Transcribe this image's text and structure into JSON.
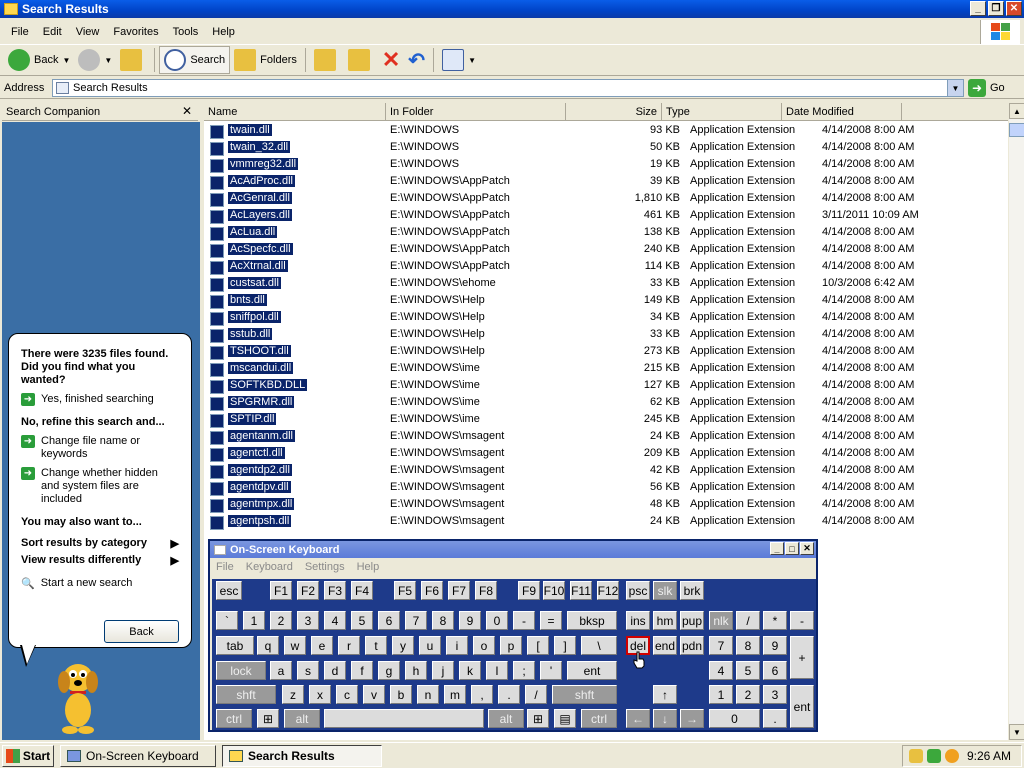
{
  "window": {
    "title": "Search Results"
  },
  "menu": [
    "File",
    "Edit",
    "View",
    "Favorites",
    "Tools",
    "Help"
  ],
  "toolbar": {
    "back": "Back",
    "search": "Search",
    "folders": "Folders"
  },
  "address": {
    "label": "Address",
    "value": "Search Results",
    "go": "Go"
  },
  "companion": {
    "title": "Search Companion",
    "found": "There were 3235 files found. Did you find what you wanted?",
    "yes": "Yes, finished searching",
    "refine": "No, refine this search and...",
    "change_name": "Change file name or keywords",
    "change_hidden": "Change whether hidden and system files are included",
    "also": "You may also want to...",
    "sort": "Sort results by category",
    "view": "View results differently",
    "new_search": "Start a new search",
    "back": "Back"
  },
  "columns": {
    "name": "Name",
    "folder": "In Folder",
    "size": "Size",
    "type": "Type",
    "date": "Date Modified"
  },
  "rows": [
    {
      "n": "twain.dll",
      "f": "E:\\WINDOWS",
      "s": "93 KB",
      "t": "Application Extension",
      "d": "4/14/2008 8:00 AM"
    },
    {
      "n": "twain_32.dll",
      "f": "E:\\WINDOWS",
      "s": "50 KB",
      "t": "Application Extension",
      "d": "4/14/2008 8:00 AM"
    },
    {
      "n": "vmmreg32.dll",
      "f": "E:\\WINDOWS",
      "s": "19 KB",
      "t": "Application Extension",
      "d": "4/14/2008 8:00 AM"
    },
    {
      "n": "AcAdProc.dll",
      "f": "E:\\WINDOWS\\AppPatch",
      "s": "39 KB",
      "t": "Application Extension",
      "d": "4/14/2008 8:00 AM"
    },
    {
      "n": "AcGenral.dll",
      "f": "E:\\WINDOWS\\AppPatch",
      "s": "1,810 KB",
      "t": "Application Extension",
      "d": "4/14/2008 8:00 AM"
    },
    {
      "n": "AcLayers.dll",
      "f": "E:\\WINDOWS\\AppPatch",
      "s": "461 KB",
      "t": "Application Extension",
      "d": "3/11/2011 10:09 AM"
    },
    {
      "n": "AcLua.dll",
      "f": "E:\\WINDOWS\\AppPatch",
      "s": "138 KB",
      "t": "Application Extension",
      "d": "4/14/2008 8:00 AM"
    },
    {
      "n": "AcSpecfc.dll",
      "f": "E:\\WINDOWS\\AppPatch",
      "s": "240 KB",
      "t": "Application Extension",
      "d": "4/14/2008 8:00 AM"
    },
    {
      "n": "AcXtrnal.dll",
      "f": "E:\\WINDOWS\\AppPatch",
      "s": "114 KB",
      "t": "Application Extension",
      "d": "4/14/2008 8:00 AM"
    },
    {
      "n": "custsat.dll",
      "f": "E:\\WINDOWS\\ehome",
      "s": "33 KB",
      "t": "Application Extension",
      "d": "10/3/2008 6:42 AM"
    },
    {
      "n": "bnts.dll",
      "f": "E:\\WINDOWS\\Help",
      "s": "149 KB",
      "t": "Application Extension",
      "d": "4/14/2008 8:00 AM"
    },
    {
      "n": "sniffpol.dll",
      "f": "E:\\WINDOWS\\Help",
      "s": "34 KB",
      "t": "Application Extension",
      "d": "4/14/2008 8:00 AM"
    },
    {
      "n": "sstub.dll",
      "f": "E:\\WINDOWS\\Help",
      "s": "33 KB",
      "t": "Application Extension",
      "d": "4/14/2008 8:00 AM"
    },
    {
      "n": "TSHOOT.dll",
      "f": "E:\\WINDOWS\\Help",
      "s": "273 KB",
      "t": "Application Extension",
      "d": "4/14/2008 8:00 AM"
    },
    {
      "n": "mscandui.dll",
      "f": "E:\\WINDOWS\\ime",
      "s": "215 KB",
      "t": "Application Extension",
      "d": "4/14/2008 8:00 AM"
    },
    {
      "n": "SOFTKBD.DLL",
      "f": "E:\\WINDOWS\\ime",
      "s": "127 KB",
      "t": "Application Extension",
      "d": "4/14/2008 8:00 AM"
    },
    {
      "n": "SPGRMR.dll",
      "f": "E:\\WINDOWS\\ime",
      "s": "62 KB",
      "t": "Application Extension",
      "d": "4/14/2008 8:00 AM"
    },
    {
      "n": "SPTIP.dll",
      "f": "E:\\WINDOWS\\ime",
      "s": "245 KB",
      "t": "Application Extension",
      "d": "4/14/2008 8:00 AM"
    },
    {
      "n": "agentanm.dll",
      "f": "E:\\WINDOWS\\msagent",
      "s": "24 KB",
      "t": "Application Extension",
      "d": "4/14/2008 8:00 AM"
    },
    {
      "n": "agentctl.dll",
      "f": "E:\\WINDOWS\\msagent",
      "s": "209 KB",
      "t": "Application Extension",
      "d": "4/14/2008 8:00 AM"
    },
    {
      "n": "agentdp2.dll",
      "f": "E:\\WINDOWS\\msagent",
      "s": "42 KB",
      "t": "Application Extension",
      "d": "4/14/2008 8:00 AM"
    },
    {
      "n": "agentdpv.dll",
      "f": "E:\\WINDOWS\\msagent",
      "s": "56 KB",
      "t": "Application Extension",
      "d": "4/14/2008 8:00 AM"
    },
    {
      "n": "agentmpx.dll",
      "f": "E:\\WINDOWS\\msagent",
      "s": "48 KB",
      "t": "Application Extension",
      "d": "4/14/2008 8:00 AM"
    },
    {
      "n": "agentpsh.dll",
      "f": "E:\\WINDOWS\\msagent",
      "s": "24 KB",
      "t": "Application Extension",
      "d": "4/14/2008 8:00 AM"
    }
  ],
  "osk": {
    "title": "On-Screen Keyboard",
    "menu": [
      "File",
      "Keyboard",
      "Settings",
      "Help"
    ]
  },
  "keys": [
    [
      "esc",
      4,
      2,
      26
    ],
    [
      "F1",
      58,
      2,
      22
    ],
    [
      "F2",
      85,
      2,
      22
    ],
    [
      "F3",
      112,
      2,
      22
    ],
    [
      "F4",
      139,
      2,
      22
    ],
    [
      "F5",
      182,
      2,
      22
    ],
    [
      "F6",
      209,
      2,
      22
    ],
    [
      "F7",
      236,
      2,
      22
    ],
    [
      "F8",
      263,
      2,
      22
    ],
    [
      "F9",
      306,
      2,
      22
    ],
    [
      "F10",
      331,
      2,
      22
    ],
    [
      "F11",
      358,
      2,
      22
    ],
    [
      "F12",
      385,
      2,
      22
    ],
    [
      "psc",
      414,
      2,
      24
    ],
    [
      "slk",
      441,
      2,
      24
    ],
    [
      "brk",
      468,
      2,
      24
    ],
    [
      "`",
      4,
      32,
      22
    ],
    [
      "1",
      31,
      32,
      22
    ],
    [
      "2",
      58,
      32,
      22
    ],
    [
      "3",
      85,
      32,
      22
    ],
    [
      "4",
      112,
      32,
      22
    ],
    [
      "5",
      139,
      32,
      22
    ],
    [
      "6",
      166,
      32,
      22
    ],
    [
      "7",
      193,
      32,
      22
    ],
    [
      "8",
      220,
      32,
      22
    ],
    [
      "9",
      247,
      32,
      22
    ],
    [
      "0",
      274,
      32,
      22
    ],
    [
      "-",
      301,
      32,
      22
    ],
    [
      "=",
      328,
      32,
      22
    ],
    [
      "bksp",
      355,
      32,
      50
    ],
    [
      "ins",
      414,
      32,
      24
    ],
    [
      "hm",
      441,
      32,
      24
    ],
    [
      "pup",
      468,
      32,
      24
    ],
    [
      "nlk",
      497,
      32,
      24
    ],
    [
      "/",
      524,
      32,
      24
    ],
    [
      "*",
      551,
      32,
      24
    ],
    [
      "-",
      578,
      32,
      24
    ],
    [
      "tab",
      4,
      57,
      38
    ],
    [
      "q",
      45,
      57,
      22
    ],
    [
      "w",
      72,
      57,
      22
    ],
    [
      "e",
      99,
      57,
      22
    ],
    [
      "r",
      126,
      57,
      22
    ],
    [
      "t",
      153,
      57,
      22
    ],
    [
      "y",
      180,
      57,
      22
    ],
    [
      "u",
      207,
      57,
      22
    ],
    [
      "i",
      234,
      57,
      22
    ],
    [
      "o",
      261,
      57,
      22
    ],
    [
      "p",
      288,
      57,
      22
    ],
    [
      "[",
      315,
      57,
      22
    ],
    [
      "]",
      342,
      57,
      22
    ],
    [
      "\\",
      369,
      57,
      36
    ],
    [
      "del",
      414,
      57,
      24
    ],
    [
      "end",
      441,
      57,
      24
    ],
    [
      "pdn",
      468,
      57,
      24
    ],
    [
      "7",
      497,
      57,
      24
    ],
    [
      "8",
      524,
      57,
      24
    ],
    [
      "9",
      551,
      57,
      24
    ],
    [
      "+",
      578,
      57,
      24
    ],
    [
      "lock",
      4,
      82,
      50
    ],
    [
      "a",
      58,
      82,
      22
    ],
    [
      "s",
      85,
      82,
      22
    ],
    [
      "d",
      112,
      82,
      22
    ],
    [
      "f",
      139,
      82,
      22
    ],
    [
      "g",
      166,
      82,
      22
    ],
    [
      "h",
      193,
      82,
      22
    ],
    [
      "j",
      220,
      82,
      22
    ],
    [
      "k",
      247,
      82,
      22
    ],
    [
      "l",
      274,
      82,
      22
    ],
    [
      ";",
      301,
      82,
      22
    ],
    [
      "'",
      328,
      82,
      22
    ],
    [
      "ent",
      355,
      82,
      50
    ],
    [
      "4",
      497,
      82,
      24
    ],
    [
      "5",
      524,
      82,
      24
    ],
    [
      "6",
      551,
      82,
      24
    ],
    [
      "shft",
      4,
      106,
      60
    ],
    [
      "z",
      70,
      106,
      22
    ],
    [
      "x",
      97,
      106,
      22
    ],
    [
      "c",
      124,
      106,
      22
    ],
    [
      "v",
      151,
      106,
      22
    ],
    [
      "b",
      178,
      106,
      22
    ],
    [
      "n",
      205,
      106,
      22
    ],
    [
      "m",
      232,
      106,
      22
    ],
    [
      ",",
      259,
      106,
      22
    ],
    [
      ".",
      286,
      106,
      22
    ],
    [
      "/",
      313,
      106,
      22
    ],
    [
      "shft",
      340,
      106,
      65
    ],
    [
      "↑",
      441,
      106,
      24
    ],
    [
      "1",
      497,
      106,
      24
    ],
    [
      "2",
      524,
      106,
      24
    ],
    [
      "3",
      551,
      106,
      24
    ],
    [
      "ent",
      578,
      106,
      24
    ],
    [
      "ctrl",
      4,
      130,
      36
    ],
    [
      "⊞",
      45,
      130,
      22
    ],
    [
      "alt",
      72,
      130,
      36
    ],
    [
      "",
      112,
      130,
      160
    ],
    [
      "alt",
      276,
      130,
      36
    ],
    [
      "⊞",
      315,
      130,
      22
    ],
    [
      "▤",
      342,
      130,
      22
    ],
    [
      "ctrl",
      369,
      130,
      36
    ],
    [
      "←",
      414,
      130,
      24
    ],
    [
      "↓",
      441,
      130,
      24
    ],
    [
      "→",
      468,
      130,
      24
    ],
    [
      "0",
      497,
      130,
      51
    ],
    [
      ".",
      551,
      130,
      24
    ]
  ],
  "taskbar": {
    "start": "Start",
    "t1": "On-Screen Keyboard",
    "t2": "Search Results",
    "clock": "9:26 AM"
  }
}
